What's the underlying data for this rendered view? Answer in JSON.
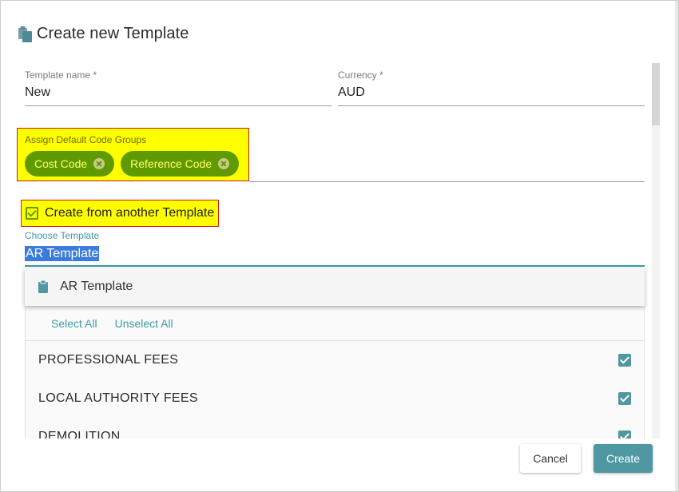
{
  "dialog": {
    "title": "Create new Template",
    "title_icon": "clipboard-copy-icon"
  },
  "fields": {
    "template_name": {
      "label": "Template name *",
      "value": "New"
    },
    "currency": {
      "label": "Currency *",
      "value": "AUD"
    }
  },
  "code_groups": {
    "label": "Assign Default Code Groups",
    "chips": [
      {
        "label": "Cost Code",
        "remove_icon": "close-circle-icon"
      },
      {
        "label": "Reference Code",
        "remove_icon": "close-circle-icon"
      }
    ]
  },
  "create_from_template": {
    "label": "Create from another Template",
    "checked": true
  },
  "choose_template": {
    "label": "Choose Template",
    "value": "AR Template",
    "dropdown_option": "AR Template",
    "option_icon": "clipboard-icon"
  },
  "selection": {
    "select_all": "Select All",
    "unselect_all": "Unselect All",
    "items": [
      {
        "name": "PROFESSIONAL FEES",
        "checked": true
      },
      {
        "name": "LOCAL AUTHORITY FEES",
        "checked": true
      },
      {
        "name": "DEMOLITION",
        "checked": true
      }
    ]
  },
  "actions": {
    "cancel": "Cancel",
    "create": "Create"
  },
  "colors": {
    "accent": "#4f98a2",
    "chip": "#5f9a00",
    "highlight": "#ffff00",
    "highlight_border": "#d01818"
  }
}
